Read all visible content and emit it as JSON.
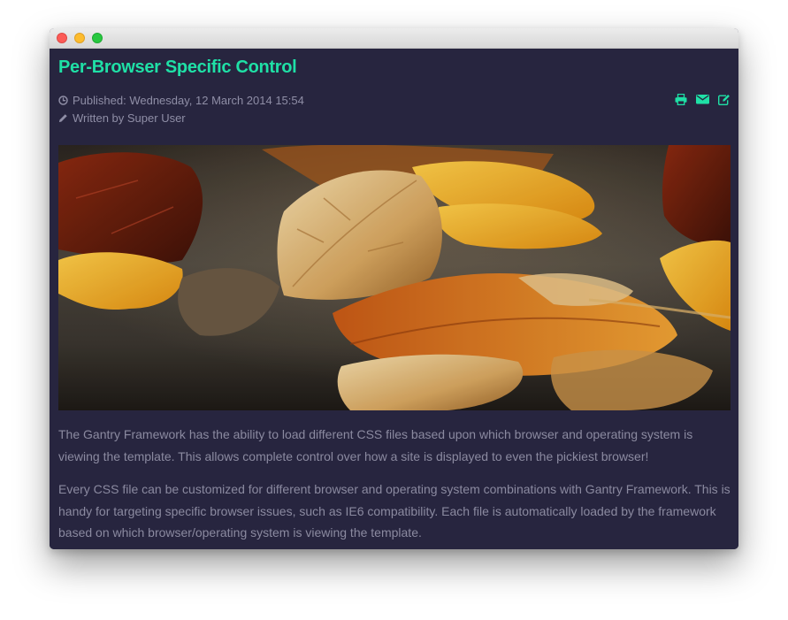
{
  "article": {
    "title": "Per-Browser Specific Control",
    "published": "Published: Wednesday, 12 March 2014 15:54",
    "author": "Written by Super User",
    "paragraphs": [
      "The Gantry Framework has the ability to load different CSS files based upon which browser and operating system is viewing the template. This allows complete control over how a site is displayed to even the pickiest browser!",
      "Every CSS file can be customized for different browser and operating system combinations with Gantry Framework. This is handy for targeting specific browser issues, such as IE6 compatibility. Each file is automatically loaded by the framework based on which browser/operating system is viewing the template."
    ]
  },
  "icons": {
    "published": "clock-icon",
    "author": "pencil-icon",
    "actions": [
      "print-icon",
      "email-icon",
      "edit-icon"
    ]
  },
  "colors": {
    "background": "#27253f",
    "accent": "#1fe0a6",
    "text": "#8b8aa0",
    "meta": "#8f8ea6"
  }
}
